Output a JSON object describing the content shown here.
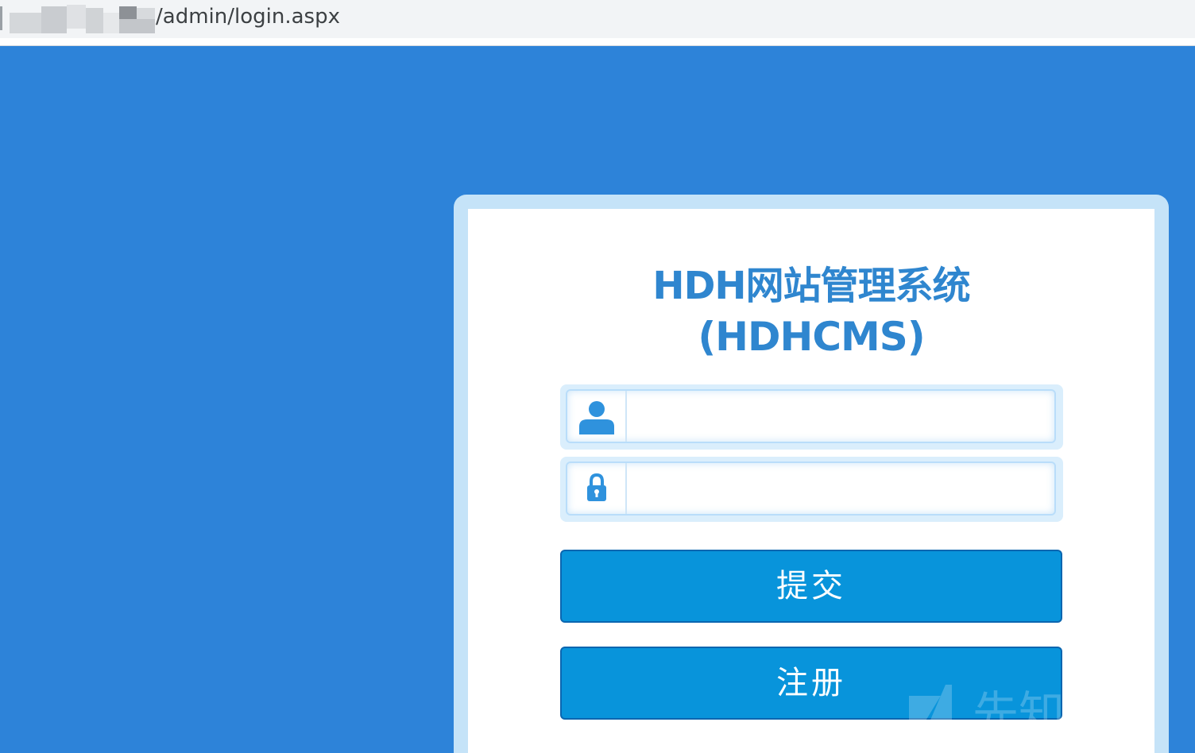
{
  "address_bar": {
    "url_path": "/admin/login.aspx"
  },
  "login": {
    "title_line1": "HDH网站管理系统",
    "title_line2": "(HDHCMS)",
    "username": {
      "value": "",
      "placeholder": ""
    },
    "password": {
      "value": "",
      "placeholder": ""
    },
    "submit_label": "提交",
    "register_label": "注册"
  },
  "watermark": {
    "text": "先知社区"
  },
  "colors": {
    "page_background": "#2d83d9",
    "card_frame": "#c5e3f8",
    "title": "#2f86cf",
    "button": "#0894db",
    "button_border": "#0b66b0",
    "icon": "#2f92dd"
  },
  "icons": [
    "user-icon",
    "lock-icon",
    "watermark-logo-icon"
  ]
}
